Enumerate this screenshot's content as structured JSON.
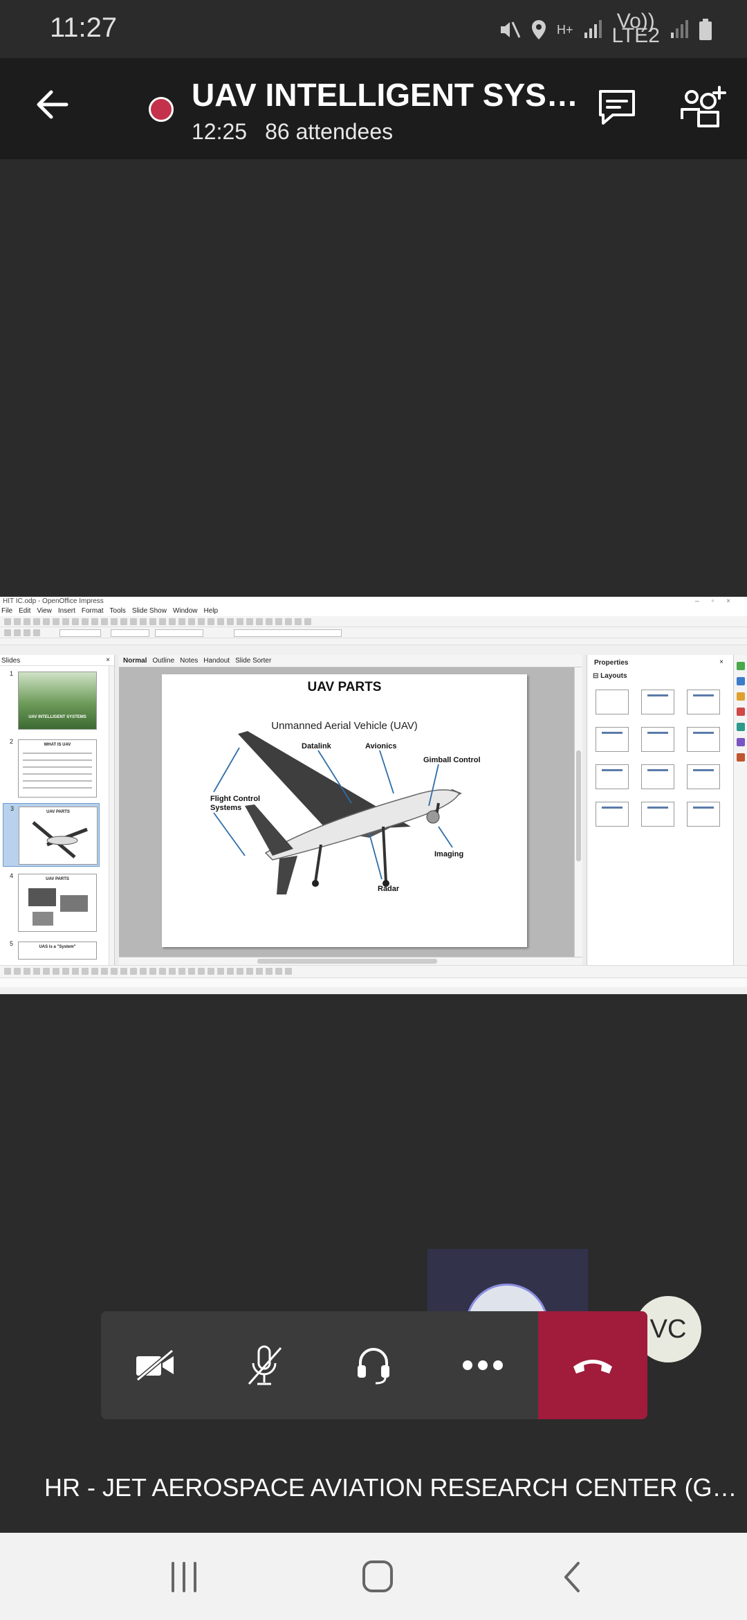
{
  "status_bar": {
    "time": "11:27",
    "network_top": "H+",
    "volte_top": "Vo))",
    "volte_bottom": "LTE2"
  },
  "meeting": {
    "title": "UAV INTELLIGENT SYST...",
    "duration": "12:25",
    "attendees": "86 attendees",
    "recording_color": "#c4314b"
  },
  "shared_screen": {
    "window_title": "HIT IC.odp - OpenOffice Impress",
    "menu": [
      "File",
      "Edit",
      "View",
      "Insert",
      "Format",
      "Tools",
      "Slide Show",
      "Window",
      "Help"
    ],
    "slides_panel_title": "Slides",
    "view_tabs": [
      "Normal",
      "Outline",
      "Notes",
      "Handout",
      "Slide Sorter"
    ],
    "thumbnails": [
      {
        "num": "1",
        "title": "UAV INTELLIGENT SYSTEMS"
      },
      {
        "num": "2",
        "title": "WHAT IS UAV"
      },
      {
        "num": "3",
        "title": "UAV PARTS"
      },
      {
        "num": "4",
        "title": "UAV PARTS"
      },
      {
        "num": "5",
        "title": "UAS is a \"System\""
      }
    ],
    "slide": {
      "title": "UAV PARTS",
      "subtitle": "Unmanned Aerial Vehicle (UAV)",
      "labels": {
        "datalink": "Datalink",
        "avionics": "Avionics",
        "gimball": "Gimball Control",
        "flight1": "Flight Control",
        "flight2": "Systems",
        "imaging": "Imaging",
        "radar": "Radar"
      }
    },
    "properties": {
      "title": "Properties",
      "section": "Layouts"
    }
  },
  "participants": {
    "vc_initials": "VC"
  },
  "active_speaker": "HR - JET AEROSPACE AVIATION RESEARCH CENTER (Gue...",
  "controls": {
    "hangup_color": "#a01c3a"
  }
}
